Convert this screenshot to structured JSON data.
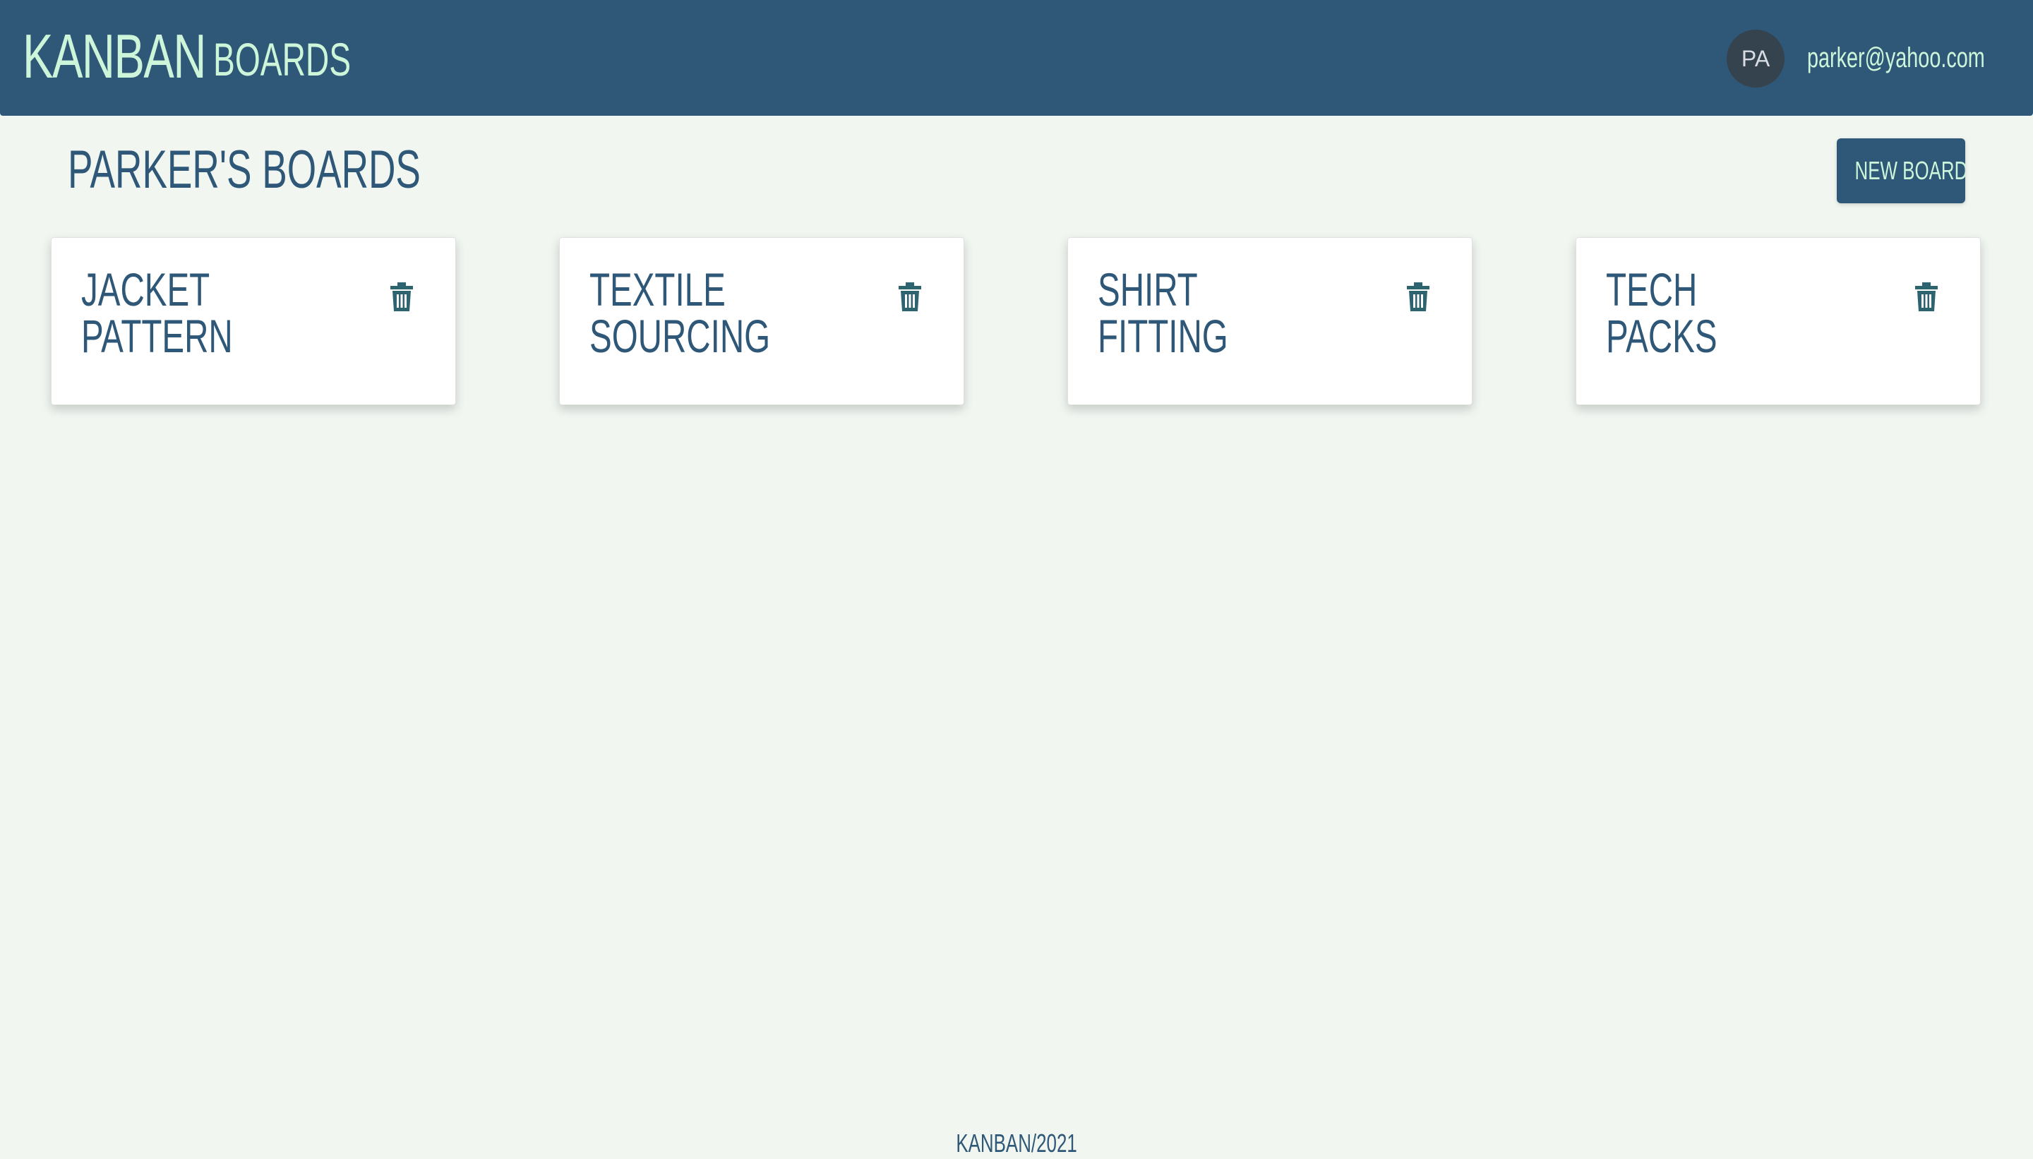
{
  "navbar": {
    "brand": "KANBAN",
    "boards_link": "BOARDS",
    "avatar_initials": "PA",
    "user_email": "parker@yahoo.com"
  },
  "main": {
    "title": "PARKER'S BOARDS",
    "new_board_label": "NEW BOARD",
    "boards": [
      {
        "title": "JACKET PATTERN",
        "icon": "trash-icon"
      },
      {
        "title": "TEXTILE SOURCING",
        "icon": "trash-icon"
      },
      {
        "title": "SHIRT FITTING",
        "icon": "trash-icon"
      },
      {
        "title": "TECH PACKS",
        "icon": "trash-icon"
      }
    ]
  },
  "footer": {
    "text": "KANBAN/2021"
  },
  "colors": {
    "primary": "#2f5878",
    "accent": "#ccf5d9",
    "background": "#f1f6f1",
    "card": "#ffffff",
    "avatar": "#35434f",
    "trash_icon": "#2e6470"
  }
}
